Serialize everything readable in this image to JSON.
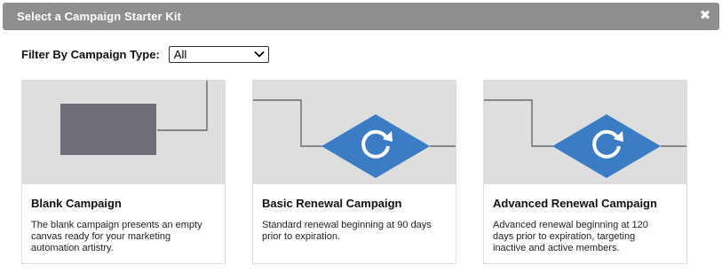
{
  "dialog": {
    "title": "Select a Campaign Starter Kit",
    "close_icon": "close-icon"
  },
  "filter": {
    "label": "Filter By Campaign Type:",
    "selected": "All"
  },
  "cards": [
    {
      "title": "Blank Campaign",
      "description": "The blank campaign presents an empty canvas ready for your marketing automation artistry.",
      "thumbnail": "blank-canvas-illustration"
    },
    {
      "title": "Basic Renewal Campaign",
      "description": "Standard renewal beginning at 90 days prior to expiration.",
      "thumbnail": "renewal-diamond-illustration"
    },
    {
      "title": "Advanced Renewal Campaign",
      "description": "Advanced renewal beginning at 120 days prior to expiration, targeting inactive and active members.",
      "thumbnail": "renewal-diamond-illustration"
    }
  ],
  "colors": {
    "titlebar": "#8e8e8e",
    "thumbnail_bg": "#dedede",
    "blank_block": "#6e6e78",
    "diamond": "#3a7dc4",
    "connector": "#6a6a6a"
  }
}
